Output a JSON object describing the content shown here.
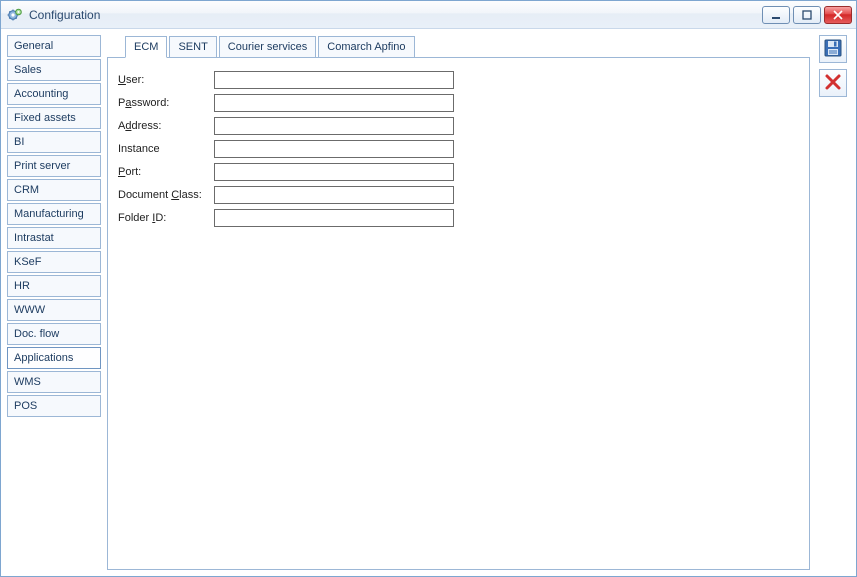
{
  "window": {
    "title": "Configuration"
  },
  "sidebar": {
    "items": [
      {
        "label": "General"
      },
      {
        "label": "Sales"
      },
      {
        "label": "Accounting"
      },
      {
        "label": "Fixed assets"
      },
      {
        "label": "BI"
      },
      {
        "label": "Print server"
      },
      {
        "label": "CRM"
      },
      {
        "label": "Manufacturing"
      },
      {
        "label": "Intrastat"
      },
      {
        "label": "KSeF"
      },
      {
        "label": "HR"
      },
      {
        "label": "WWW"
      },
      {
        "label": "Doc. flow"
      },
      {
        "label": "Applications"
      },
      {
        "label": "WMS"
      },
      {
        "label": "POS"
      }
    ],
    "selected_index": 13
  },
  "tabs": {
    "items": [
      {
        "label": "ECM"
      },
      {
        "label": "SENT"
      },
      {
        "label": "Courier services"
      },
      {
        "label": "Comarch Apfino"
      }
    ],
    "active_index": 0
  },
  "form": {
    "fields": [
      {
        "label_pre": "",
        "label_ul": "U",
        "label_post": "ser:",
        "value": ""
      },
      {
        "label_pre": "P",
        "label_ul": "a",
        "label_post": "ssword:",
        "value": ""
      },
      {
        "label_pre": "A",
        "label_ul": "d",
        "label_post": "dress:",
        "value": ""
      },
      {
        "label_pre": "Instance",
        "label_ul": "",
        "label_post": "",
        "value": ""
      },
      {
        "label_pre": "",
        "label_ul": "P",
        "label_post": "ort:",
        "value": ""
      },
      {
        "label_pre": "Document ",
        "label_ul": "C",
        "label_post": "lass:",
        "value": ""
      },
      {
        "label_pre": "Folder ",
        "label_ul": "I",
        "label_post": "D:",
        "value": ""
      }
    ]
  },
  "icons": {
    "app": "gear-icon",
    "save": "save-icon",
    "close": "close-x-icon"
  }
}
